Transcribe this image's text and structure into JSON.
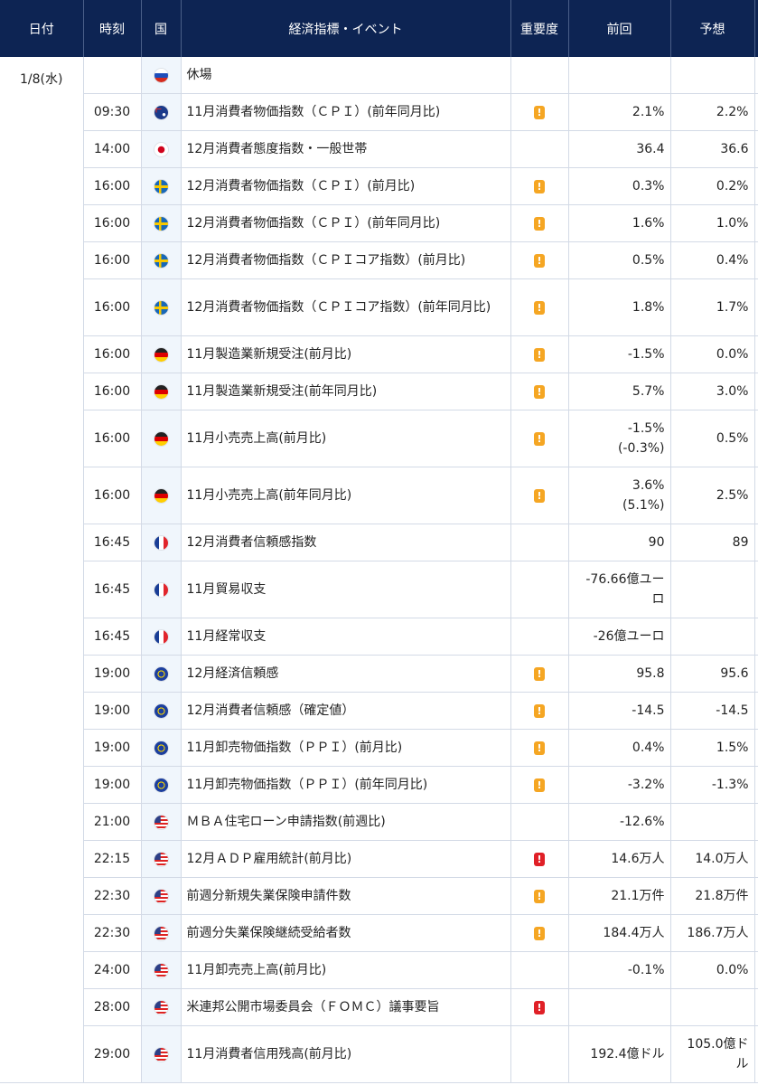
{
  "header": {
    "date": "日付",
    "time": "時刻",
    "country": "国",
    "event": "経済指標・イベント",
    "importance": "重要度",
    "previous": "前回",
    "forecast": "予想"
  },
  "date_label": "1/8(水)",
  "colors": {
    "header_bg": "#0d2453",
    "importance_mid": "#f5a623",
    "importance_high": "#e02027",
    "flag_col_bg": "#f0f6fc"
  },
  "rows": [
    {
      "time": "",
      "flag": "ru-flag-icon",
      "event": "休場",
      "importance": "",
      "prev": "",
      "prev2": "",
      "forecast": ""
    },
    {
      "time": "09:30",
      "flag": "au-flag-icon",
      "event": "11月消費者物価指数（ＣＰＩ）(前年同月比)",
      "importance": "!",
      "prev": "2.1%",
      "prev2": "",
      "forecast": "2.2%"
    },
    {
      "time": "14:00",
      "flag": "jp-flag-icon",
      "event": "12月消費者態度指数・一般世帯",
      "importance": "",
      "prev": "36.4",
      "prev2": "",
      "forecast": "36.6"
    },
    {
      "time": "16:00",
      "flag": "se-flag-icon",
      "event": "12月消費者物価指数（ＣＰＩ）(前月比)",
      "importance": "!",
      "prev": "0.3%",
      "prev2": "",
      "forecast": "0.2%"
    },
    {
      "time": "16:00",
      "flag": "se-flag-icon",
      "event": "12月消費者物価指数（ＣＰＩ）(前年同月比)",
      "importance": "!",
      "prev": "1.6%",
      "prev2": "",
      "forecast": "1.0%"
    },
    {
      "time": "16:00",
      "flag": "se-flag-icon",
      "event": "12月消費者物価指数（ＣＰＩコア指数）(前月比)",
      "importance": "!",
      "prev": "0.5%",
      "prev2": "",
      "forecast": "0.4%"
    },
    {
      "time": "16:00",
      "flag": "se-flag-icon",
      "event": "12月消費者物価指数（ＣＰＩコア指数）(前年同月比)",
      "importance": "!",
      "prev": "1.8%",
      "prev2": "",
      "forecast": "1.7%"
    },
    {
      "time": "16:00",
      "flag": "de-flag-icon",
      "event": "11月製造業新規受注(前月比)",
      "importance": "!",
      "prev": "-1.5%",
      "prev2": "",
      "forecast": "0.0%"
    },
    {
      "time": "16:00",
      "flag": "de-flag-icon",
      "event": "11月製造業新規受注(前年同月比)",
      "importance": "!",
      "prev": "5.7%",
      "prev2": "",
      "forecast": "3.0%"
    },
    {
      "time": "16:00",
      "flag": "de-flag-icon",
      "event": "11月小売売上高(前月比)",
      "importance": "!",
      "prev": "-1.5%",
      "prev2": "(-0.3%)",
      "forecast": "0.5%"
    },
    {
      "time": "16:00",
      "flag": "de-flag-icon",
      "event": "11月小売売上高(前年同月比)",
      "importance": "!",
      "prev": "3.6%",
      "prev2": "(5.1%)",
      "forecast": "2.5%"
    },
    {
      "time": "16:45",
      "flag": "fr-flag-icon",
      "event": "12月消費者信頼感指数",
      "importance": "",
      "prev": "90",
      "prev2": "",
      "forecast": "89"
    },
    {
      "time": "16:45",
      "flag": "fr-flag-icon",
      "event": "11月貿易収支",
      "importance": "",
      "prev": "-76.66億ユーロ",
      "prev2": "",
      "forecast": ""
    },
    {
      "time": "16:45",
      "flag": "fr-flag-icon",
      "event": "11月経常収支",
      "importance": "",
      "prev": "-26億ユーロ",
      "prev2": "",
      "forecast": ""
    },
    {
      "time": "19:00",
      "flag": "eu-flag-icon",
      "event": "12月経済信頼感",
      "importance": "!",
      "prev": "95.8",
      "prev2": "",
      "forecast": "95.6"
    },
    {
      "time": "19:00",
      "flag": "eu-flag-icon",
      "event": "12月消費者信頼感（確定値）",
      "importance": "!",
      "prev": "-14.5",
      "prev2": "",
      "forecast": "-14.5"
    },
    {
      "time": "19:00",
      "flag": "eu-flag-icon",
      "event": "11月卸売物価指数（ＰＰＩ）(前月比)",
      "importance": "!",
      "prev": "0.4%",
      "prev2": "",
      "forecast": "1.5%"
    },
    {
      "time": "19:00",
      "flag": "eu-flag-icon",
      "event": "11月卸売物価指数（ＰＰＩ）(前年同月比)",
      "importance": "!",
      "prev": "-3.2%",
      "prev2": "",
      "forecast": "-1.3%"
    },
    {
      "time": "21:00",
      "flag": "us-flag-icon",
      "event": "ＭＢＡ住宅ローン申請指数(前週比)",
      "importance": "",
      "prev": "-12.6%",
      "prev2": "",
      "forecast": ""
    },
    {
      "time": "22:15",
      "flag": "us-flag-icon",
      "event": "12月ＡＤＰ雇用統計(前月比)",
      "importance": "!!",
      "prev": "14.6万人",
      "prev2": "",
      "forecast": "14.0万人"
    },
    {
      "time": "22:30",
      "flag": "us-flag-icon",
      "event": "前週分新規失業保険申請件数",
      "importance": "!",
      "prev": "21.1万件",
      "prev2": "",
      "forecast": "21.8万件"
    },
    {
      "time": "22:30",
      "flag": "us-flag-icon",
      "event": "前週分失業保険継続受給者数",
      "importance": "!",
      "prev": "184.4万人",
      "prev2": "",
      "forecast": "186.7万人"
    },
    {
      "time": "24:00",
      "flag": "us-flag-icon",
      "event": "11月卸売売上高(前月比)",
      "importance": "",
      "prev": "-0.1%",
      "prev2": "",
      "forecast": "0.0%"
    },
    {
      "time": "28:00",
      "flag": "us-flag-icon",
      "event": "米連邦公開市場委員会（ＦＯＭＣ）議事要旨",
      "importance": "!!",
      "prev": "",
      "prev2": "",
      "forecast": ""
    },
    {
      "time": "29:00",
      "flag": "us-flag-icon",
      "event": "11月消費者信用残高(前月比)",
      "importance": "",
      "prev": "192.4億ドル",
      "prev2": "",
      "forecast": "105.0億ドル"
    }
  ]
}
